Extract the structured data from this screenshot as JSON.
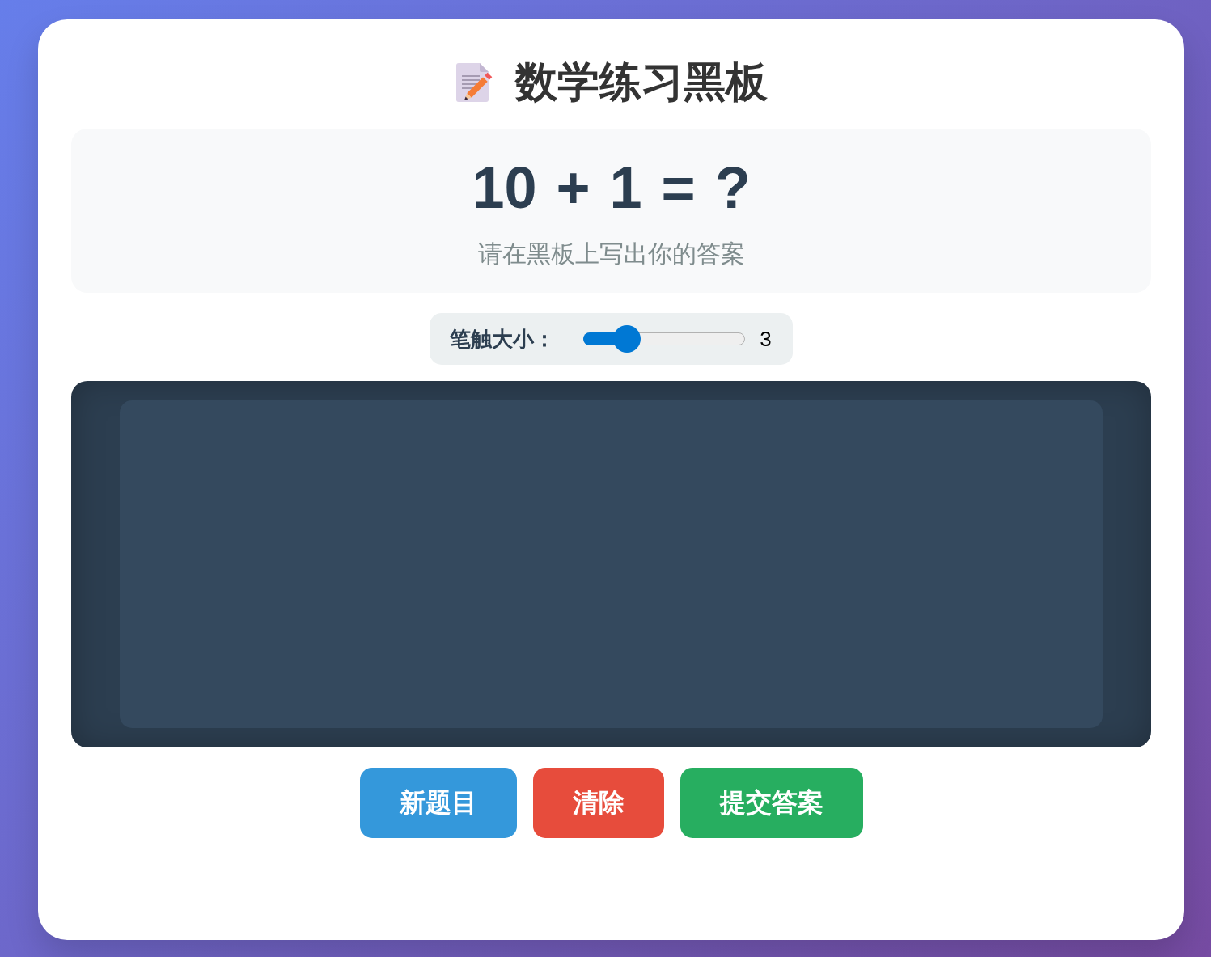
{
  "header": {
    "title": "数学练习黑板"
  },
  "problem": {
    "equation": "10 + 1 = ?",
    "instruction": "请在黑板上写出你的答案"
  },
  "brush": {
    "label": "笔触大小：",
    "level": 0.22,
    "reading": "3"
  },
  "buttons": [
    {
      "label": "新题目",
      "kind": "new"
    },
    {
      "label": "清除",
      "kind": "clear"
    },
    {
      "label": "提交答案",
      "kind": "submit"
    }
  ]
}
